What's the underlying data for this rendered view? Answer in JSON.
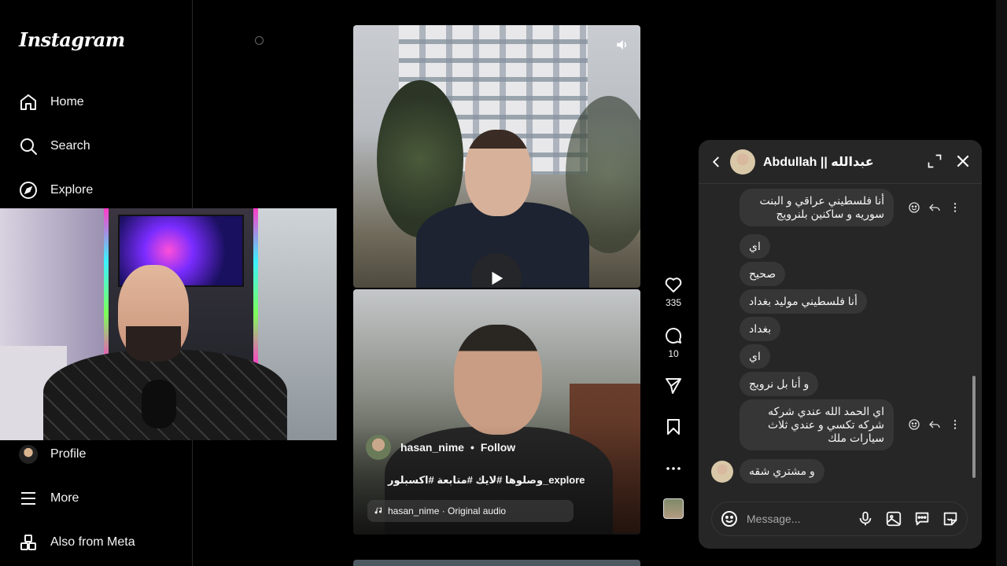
{
  "app": {
    "logo": "Instagram"
  },
  "sidebar": {
    "items": [
      {
        "label": "Home",
        "icon": "home-icon"
      },
      {
        "label": "Search",
        "icon": "search-icon"
      },
      {
        "label": "Explore",
        "icon": "compass-icon"
      },
      {
        "label": "Profile",
        "icon": "avatar"
      },
      {
        "label": "More",
        "icon": "menu-icon"
      },
      {
        "label": "Also from Meta",
        "icon": "meta-apps-icon"
      }
    ]
  },
  "reel": {
    "username": "hasan_nime",
    "separator": "•",
    "follow_label": "Follow",
    "caption": "وصلوها #لايك #متابعة #اكسبلور_explore",
    "audio": "hasan_nime · Original audio"
  },
  "actions": {
    "likes": "335",
    "comments": "10"
  },
  "chat": {
    "name": "Abdullah || عبدالله",
    "messages": [
      {
        "text": "أنا فلسطيني عراقي و البنت سوريه و ساكنين بلنرويج"
      },
      {
        "text": "اي"
      },
      {
        "text": "صحيح"
      },
      {
        "text": "أنا فلسطيني موليد بغداد"
      },
      {
        "text": "بغداد"
      },
      {
        "text": "اي"
      },
      {
        "text": "و أنا بل نرويج"
      },
      {
        "text": "اي الحمد الله عندي شركه شركه تكسي و عندي ثلاث سيارات ملك"
      },
      {
        "text": "و مشتري شقه"
      }
    ],
    "composer_placeholder": "Message..."
  },
  "colors": {
    "background": "#000000",
    "chat_panel": "#262626",
    "bubble": "#363636",
    "text": "#f5f5f5"
  }
}
